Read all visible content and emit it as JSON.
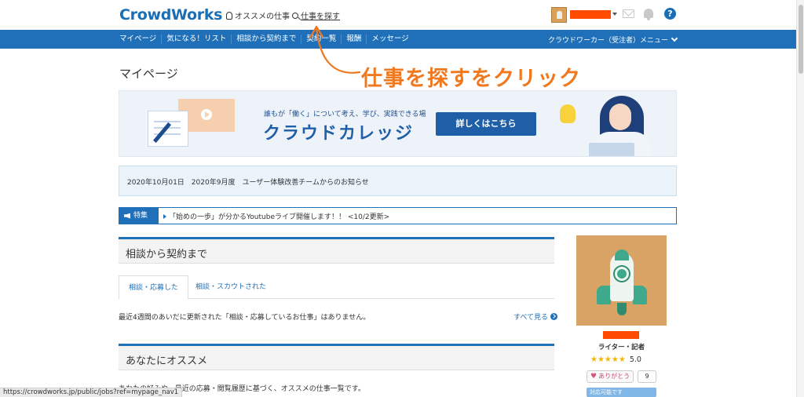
{
  "header": {
    "logo": "CrowdWorks",
    "recommended_link": "オススメの仕事",
    "find_jobs_link": "仕事を探す"
  },
  "navbar": {
    "items": [
      "マイページ",
      "気になる！リスト",
      "相談から契約まで",
      "契約一覧",
      "報酬",
      "メッセージ"
    ],
    "user_menu": "クラウドワーカー（受注者）メニュー"
  },
  "annotation": {
    "text": "仕事を探すをクリック",
    "color": "#f0781e"
  },
  "page": {
    "title": "マイページ"
  },
  "banner": {
    "subtitle": "誰もが「働く」について考え、学び、実践できる場",
    "title": "クラウドカレッジ",
    "button": "詳しくはこちら"
  },
  "notice": {
    "text": "2020年10月01日　2020年9月度　ユーザー体験改善チームからのお知らせ"
  },
  "feature": {
    "label": "特集",
    "text": "「始めの一歩」が分かるYoutubeライブ開催します！！ <10/2更新>"
  },
  "consultation": {
    "heading": "相談から契約まで",
    "tabs": [
      "相談・応募した",
      "相談・スカウトされた"
    ],
    "empty_message": "最近4週間のあいだに更新された「相談・応募しているお仕事」はありません。",
    "see_all": "すべて見る"
  },
  "recommended": {
    "heading": "あなたにオススメ",
    "description": "あなたの好みや、最近の応募・閲覧履歴に基づく、オススメの仕事一覧です。"
  },
  "profile": {
    "role": "ライター・記者",
    "stars": "★★★★★",
    "rating": "5.0",
    "thanks_label": "ありがとう",
    "thanks_count": "9",
    "status": "対応可能です"
  },
  "status_bar": {
    "url": "https://crowdworks.jp/public/jobs?ref=mypage_nav1"
  },
  "colors": {
    "brand_blue": "#1f70b8",
    "redaction": "#ff4a00",
    "star": "#f2b705"
  }
}
